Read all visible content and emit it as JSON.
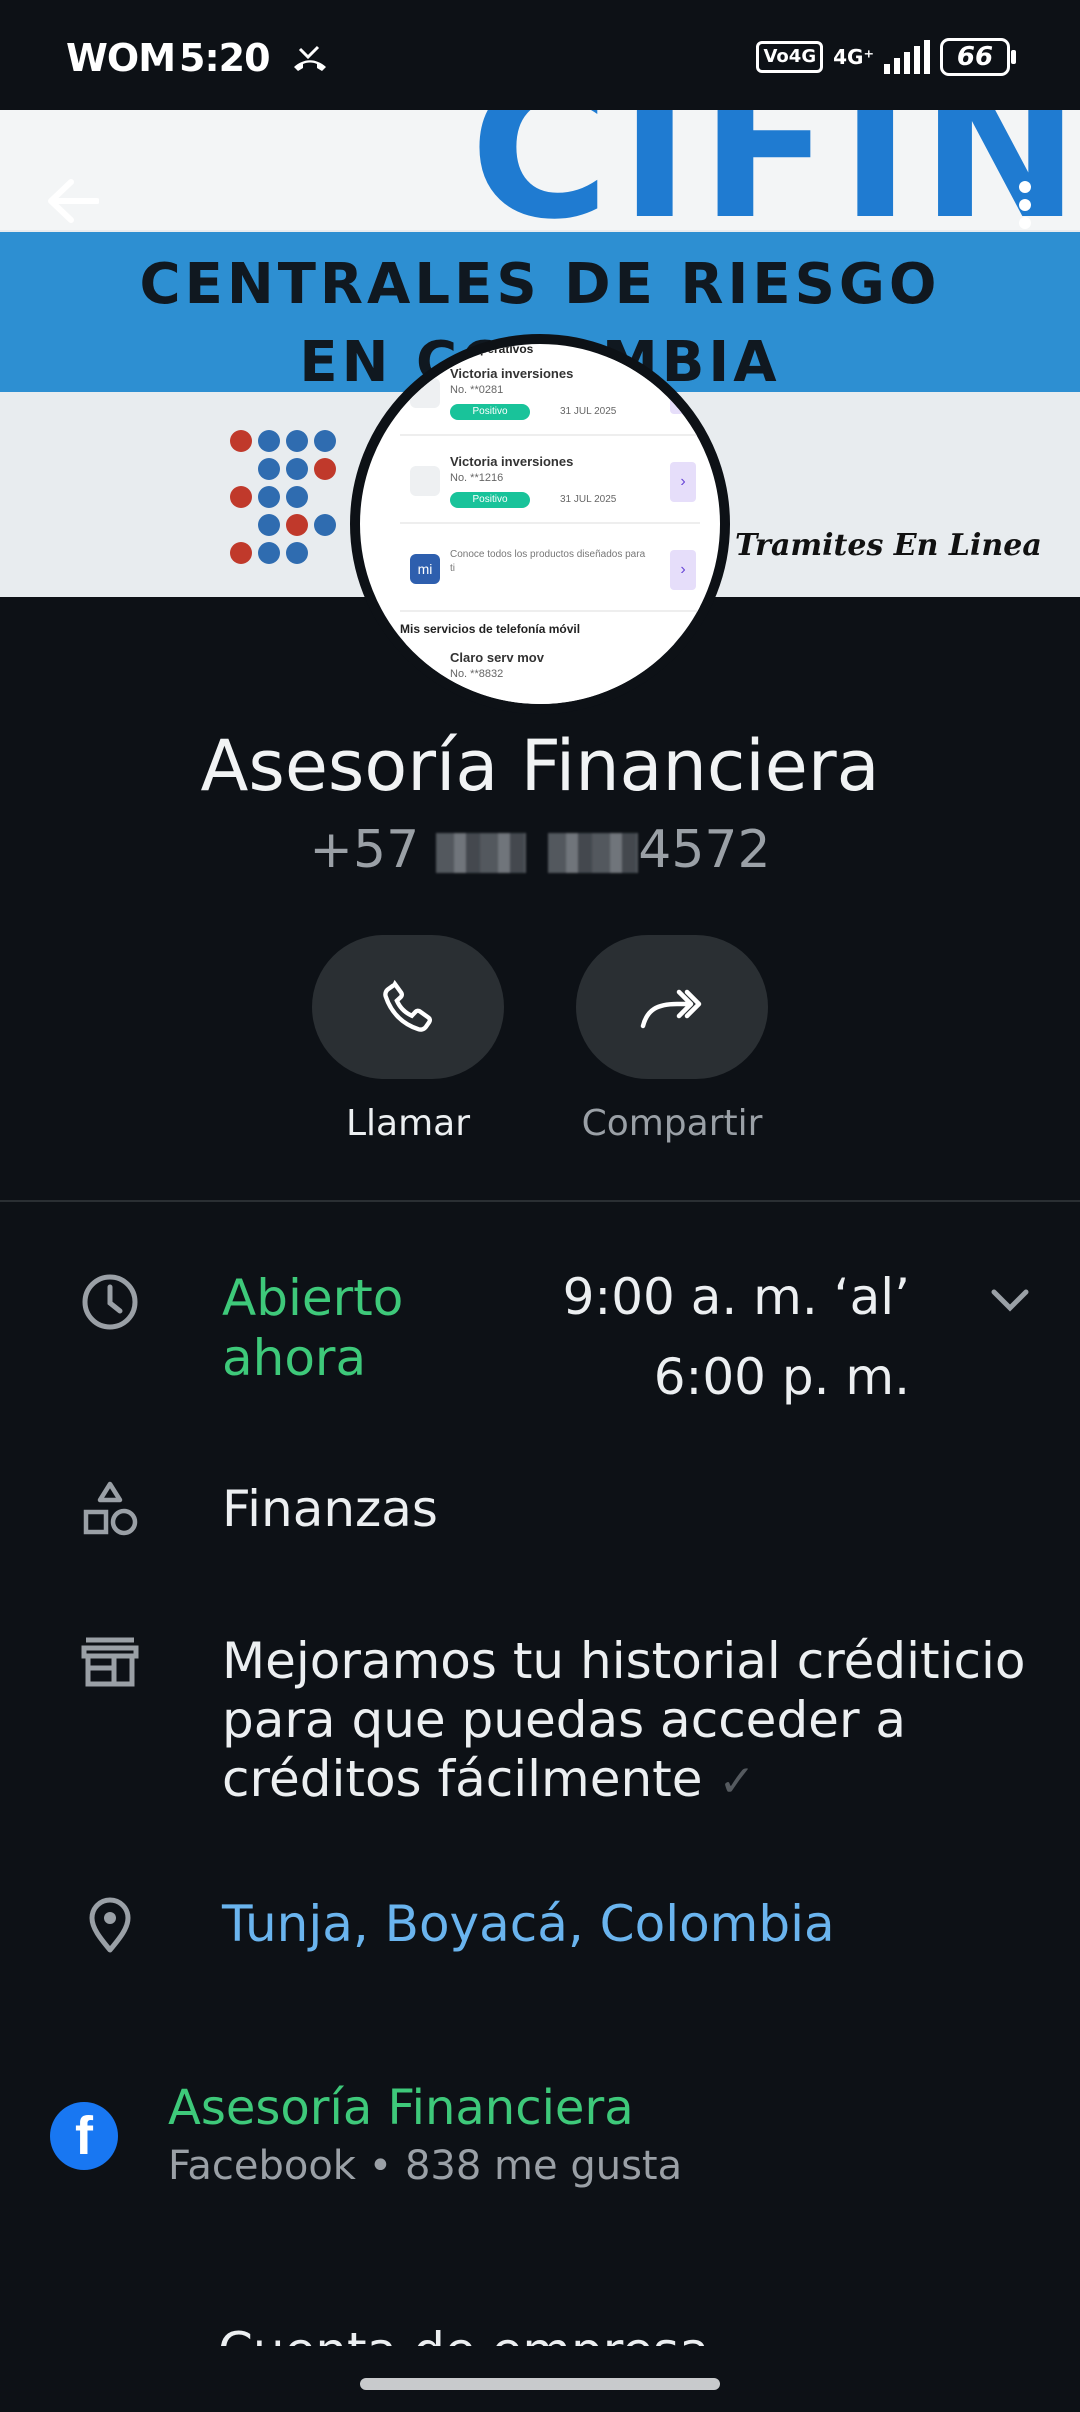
{
  "status_bar": {
    "carrier": "WOM",
    "time": "5:20",
    "volte": "Vo4G",
    "network": "4G⁺",
    "battery": "66"
  },
  "header": {
    "banner_big": "CIFIN",
    "banner_line1": "CENTRALES DE RIESGO",
    "banner_line2": "EN COLOMBIA",
    "banner_side": "Tramites En Linea"
  },
  "avatar": {
    "section_top": "...perativos",
    "cards": [
      {
        "title": "Victoria inversiones",
        "number": "No. **0281",
        "status": "Positivo",
        "date": "31 JUL 2025"
      },
      {
        "title": "Victoria inversiones",
        "number": "No. **1216",
        "status": "Positivo",
        "date": "31 JUL 2025"
      }
    ],
    "promo_icon": "mi",
    "promo_text": "Conoce todos los productos diseñados para ti",
    "section_mobile": "Mis servicios de telefonía móvil",
    "mobile_title": "Claro serv mov",
    "mobile_number": "No. **8832"
  },
  "contact": {
    "name": "Asesoría Financiera",
    "phone_prefix": "+57",
    "phone_suffix": "4572"
  },
  "actions": {
    "call_label": "Llamar",
    "share_label": "Compartir"
  },
  "info": {
    "open_status": "Abierto ahora",
    "hours_line1": "9:00 a. m. ‘al’",
    "hours_line2": "6:00 p. m.",
    "category": "Finanzas",
    "description": "Mejoramos tu historial créditicio para que puedas acceder a créditos fácilmente",
    "description_mark": "✓",
    "location": "Tunja, Boyacá, Colombia"
  },
  "facebook": {
    "name": "Asesoría Financiera",
    "meta": "Facebook • 838 me gusta"
  },
  "business_account": "Cuenta de empresa",
  "colors": {
    "background": "#0d1116",
    "open_green": "#3ec97a",
    "link_blue": "#6ab4ee",
    "facebook_blue": "#1877f2"
  }
}
